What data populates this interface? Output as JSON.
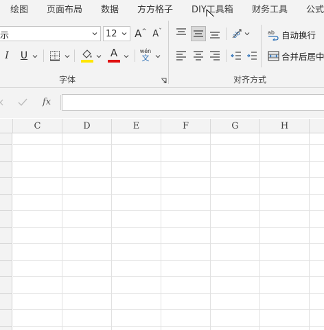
{
  "tabs": [
    {
      "id": "draw",
      "label": "绘图"
    },
    {
      "id": "page-layout",
      "label": "页面布局"
    },
    {
      "id": "data",
      "label": "数据"
    },
    {
      "id": "fangfang",
      "label": "方方格子"
    },
    {
      "id": "diy-toolbox",
      "label": "DIY工具箱"
    },
    {
      "id": "finance",
      "label": "财务工具"
    },
    {
      "id": "formula",
      "label": "公式"
    }
  ],
  "font": {
    "name_value": " ",
    "size_value": "12",
    "increase_label": "A",
    "decrease_label": "A",
    "italic_label": "I",
    "underline_label": "U",
    "phonetic_top": "wén",
    "phonetic_bottom": "文",
    "font_color_label": "A",
    "group_label": "字体"
  },
  "alignment": {
    "wrap_text_label": "自动换行",
    "merge_center_label": "合并后居中",
    "group_label": "对齐方式"
  },
  "formula_bar": {
    "fx_label": "fx",
    "value": ""
  },
  "grid": {
    "columns": [
      "C",
      "D",
      "E",
      "F",
      "G",
      "H"
    ]
  },
  "colors": {
    "highlight": "#ffe600",
    "font_color": "#e01010",
    "ribbon_bg": "#f3f3f3",
    "blue_icon": "#2b6fb6"
  }
}
